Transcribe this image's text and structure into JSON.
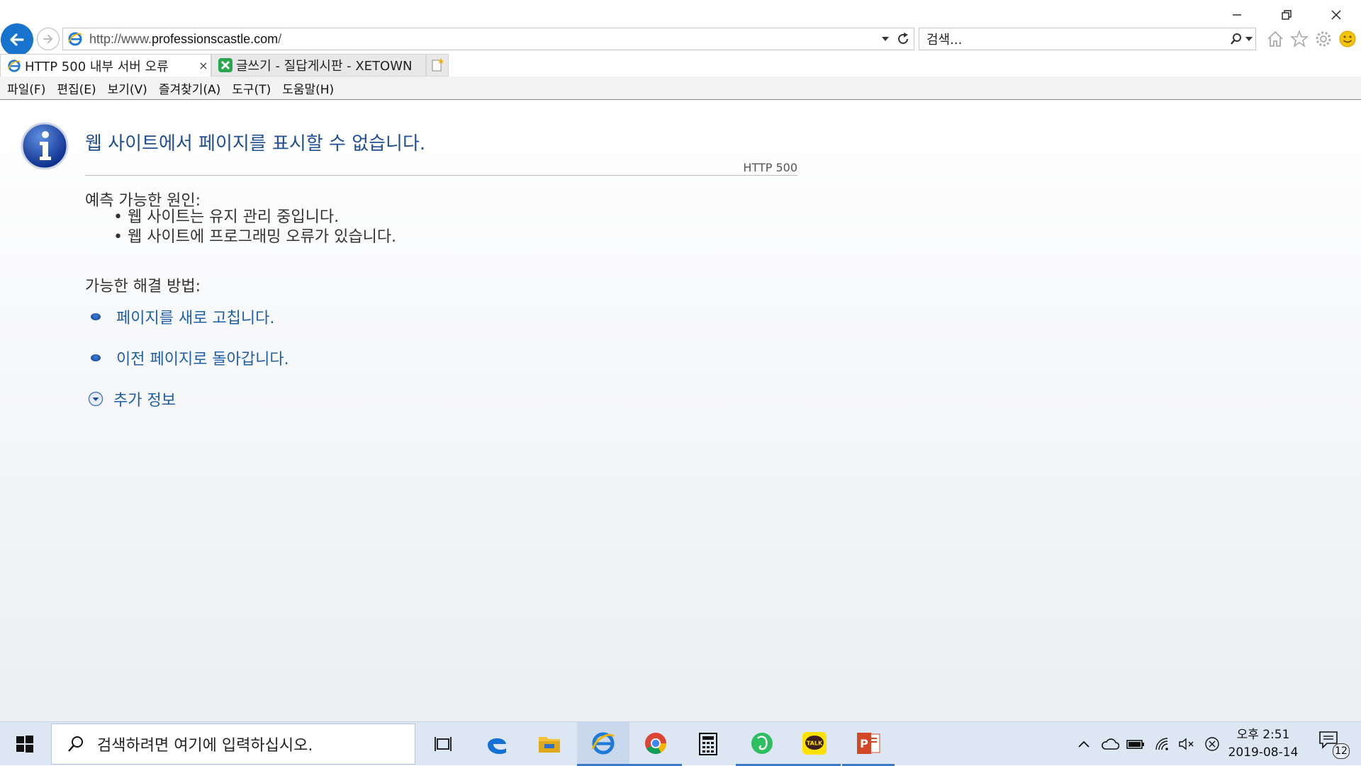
{
  "window": {
    "minimize_label": "",
    "restore_label": "",
    "close_label": ""
  },
  "address_bar": {
    "url_prefix": "http://www.",
    "url_domain": "professionscastle.com",
    "url_suffix": "/"
  },
  "search": {
    "placeholder": "검색..."
  },
  "tabs": [
    {
      "title": "HTTP 500 내부 서버 오류",
      "close": "×",
      "active": true
    },
    {
      "title": "글쓰기 - 질답게시판 - XETOWN",
      "active": false
    }
  ],
  "menu": [
    "파일(F)",
    "편집(E)",
    "보기(V)",
    "즐겨찾기(A)",
    "도구(T)",
    "도움말(H)"
  ],
  "error_page": {
    "title": "웹 사이트에서 페이지를 표시할 수 없습니다.",
    "code": "HTTP 500",
    "causes_label": "예측 가능한 원인:",
    "causes": [
      "웹 사이트는 유지 관리 중입니다.",
      "웹 사이트에 프로그래밍 오류가 있습니다."
    ],
    "solutions_label": "가능한 해결 방법:",
    "solutions": [
      "페이지를 새로 고칩니다.",
      "이전 페이지로 돌아갑니다."
    ],
    "more_info": "추가 정보"
  },
  "taskbar": {
    "search_placeholder": "검색하려면 여기에 입력하십시오.",
    "apps": [
      "task-view",
      "edge",
      "file-explorer",
      "internet-explorer",
      "chrome",
      "calculator",
      "evernote",
      "kakaotalk",
      "powerpoint"
    ],
    "kakaotalk_label": "TALK",
    "powerpoint_label": "P",
    "clock_time": "오후 2:51",
    "clock_date": "2019-08-14",
    "notification_count": "12"
  },
  "colors": {
    "accent_blue": "#1873cc",
    "link_blue": "#1e5fa8",
    "title_blue": "#1f4e93",
    "taskbar_bg": "#dde7f4"
  }
}
